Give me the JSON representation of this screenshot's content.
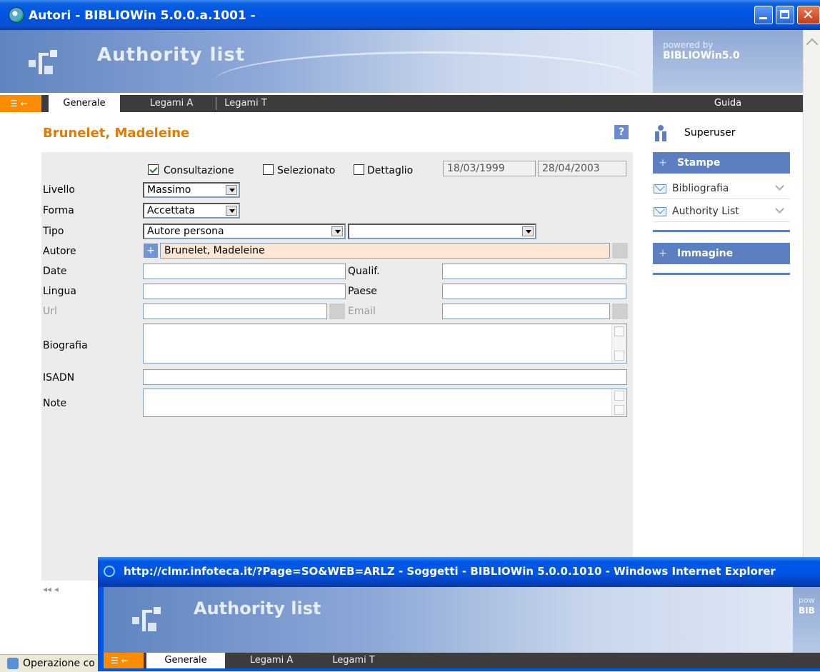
{
  "window": {
    "title": "Autori - BIBLIOWin 5.0.0.a.1001 -"
  },
  "banner": {
    "title": "Authority list",
    "powered_by": "powered by",
    "product": "BIBLIOWin5.0"
  },
  "tabs": [
    {
      "label": "Generale",
      "active": true
    },
    {
      "label": "Legami A",
      "active": false
    },
    {
      "label": "Legami T",
      "active": false
    }
  ],
  "help_tab": "Guida",
  "record": {
    "heading": "Brunelet, Madeleine",
    "help_label": "?"
  },
  "form": {
    "checkboxes": [
      {
        "label": "Consultazione",
        "checked": true
      },
      {
        "label": "Selezionato",
        "checked": false
      },
      {
        "label": "Dettaglio",
        "checked": false
      }
    ],
    "date_created": "18/03/1999",
    "date_modified": "28/04/2003",
    "livello": {
      "label": "Livello",
      "value": "Massimo"
    },
    "forma": {
      "label": "Forma",
      "value": "Accettata"
    },
    "tipo": {
      "label": "Tipo",
      "value": "Autore persona",
      "value2": ""
    },
    "autore": {
      "label": "Autore",
      "value": "Brunelet, Madeleine",
      "plus": "+"
    },
    "date": {
      "label": "Date",
      "value": ""
    },
    "qualif": {
      "label": "Qualif.",
      "value": ""
    },
    "lingua": {
      "label": "Lingua",
      "value": ""
    },
    "paese": {
      "label": "Paese",
      "value": ""
    },
    "url": {
      "label": "Url",
      "value": ""
    },
    "email": {
      "label": "Email",
      "value": ""
    },
    "biografia": {
      "label": "Biografia",
      "value": ""
    },
    "isadn": {
      "label": "ISADN",
      "value": ""
    },
    "note": {
      "label": "Note",
      "value": ""
    }
  },
  "sidebar": {
    "user": "Superuser",
    "sections": [
      {
        "title": "Stampe",
        "plus": "+",
        "items": [
          "Bibliografia",
          "Authority List"
        ]
      },
      {
        "title": "Immagine",
        "plus": "+",
        "items": []
      }
    ]
  },
  "pager": "◂◂ ◂",
  "status": {
    "text": "Operazione co"
  },
  "second_window": {
    "title": "http://clmr.infoteca.it/?Page=SO&WEB=ARLZ - Soggetti - BIBLIOWin 5.0.0.1010 - Windows Internet Explorer",
    "banner_title": "Authority list",
    "powered_by": "pow",
    "product": "BIB",
    "tabs": [
      "Generale",
      "Legami A",
      "Legami T"
    ]
  },
  "colors": {
    "accent_orange": "#e07b00",
    "panel_blue": "#5c7fc2",
    "titlebar_blue": "#0054e3"
  }
}
